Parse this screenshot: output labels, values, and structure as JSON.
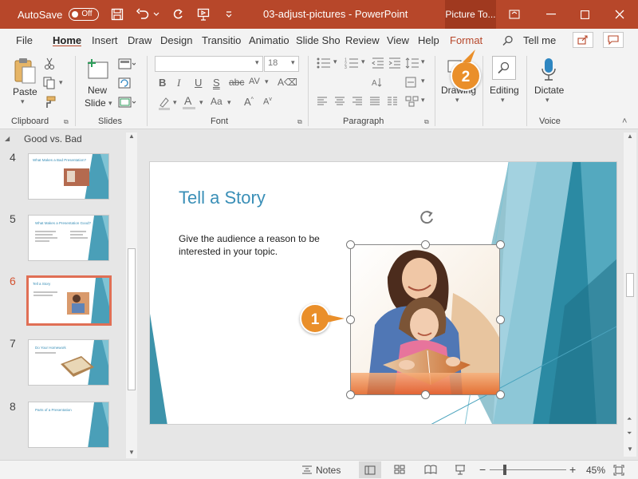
{
  "titlebar": {
    "autosave_label": "AutoSave",
    "autosave_state": "Off",
    "doc_title": "03-adjust-pictures  -  PowerPoint",
    "contextual_tab": "Picture To..."
  },
  "tabs": [
    "File",
    "Home",
    "Insert",
    "Draw",
    "Design",
    "Transitio",
    "Animatio",
    "Slide Sho",
    "Review",
    "View",
    "Help",
    "Format"
  ],
  "tell_me": "Tell me",
  "ribbon": {
    "clipboard": {
      "label": "Clipboard",
      "paste": "Paste"
    },
    "slides": {
      "label": "Slides",
      "new_slide": "New",
      "new_slide2": "Slide"
    },
    "font": {
      "label": "Font",
      "font_name": "",
      "font_size": "18"
    },
    "paragraph": {
      "label": "Paragraph"
    },
    "drawing": {
      "label": "Drawing"
    },
    "editing": {
      "label": "Editing"
    },
    "voice": {
      "label": "Voice",
      "dictate": "Dictate"
    }
  },
  "thumbnails": {
    "section": "Good vs. Bad",
    "slides": [
      {
        "num": "4",
        "title": "What Makes a Bad Presentation?"
      },
      {
        "num": "5",
        "title": "What Makes a Presentation Good?"
      },
      {
        "num": "6",
        "title": "Tell a Story"
      },
      {
        "num": "7",
        "title": "Do Your Homework"
      },
      {
        "num": "8",
        "title": "Parts of a Presentation"
      }
    ]
  },
  "slide": {
    "title": "Tell a Story",
    "body": "Give the audience a reason to be interested in your topic."
  },
  "statusbar": {
    "notes": "Notes",
    "zoom": "45%"
  },
  "callouts": {
    "one": "1",
    "two": "2"
  },
  "colors": {
    "accent": "#b7472a",
    "title_blue": "#3a8fb7",
    "callout": "#ea8f2a"
  }
}
